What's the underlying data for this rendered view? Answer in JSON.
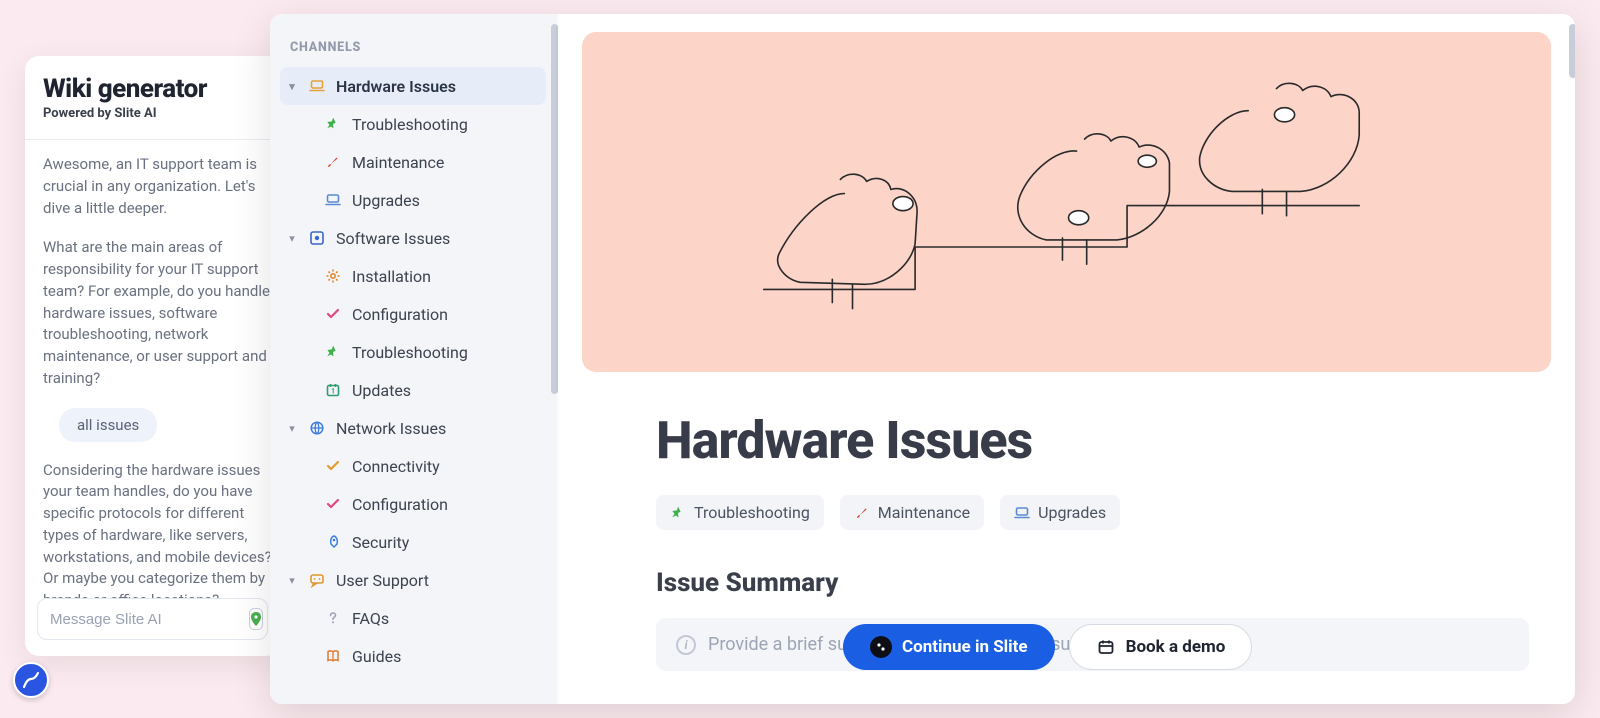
{
  "chat": {
    "title": "Wiki generator",
    "subtitle": "Powered by Slite AI",
    "messages": [
      "Awesome, an IT support team is crucial in any organization. Let's dive a little deeper.",
      "What are the main areas of responsibility for your IT support team? For example, do you handle hardware issues, software troubleshooting, network maintenance, or user support and training?"
    ],
    "user_reply": "all issues",
    "followup": "Considering the hardware issues your team handles, do you have specific protocols for different types of hardware, like servers, workstations, and mobile devices? Or maybe you categorize them by brands or office locations?",
    "input_placeholder": "Message Slite AI"
  },
  "sidebar": {
    "header": "CHANNELS",
    "channels": [
      {
        "label": "Hardware Issues",
        "icon": "laptop-icon",
        "icon_color": "#e7a13a",
        "items": [
          {
            "label": "Troubleshooting",
            "icon": "pin-icon",
            "icon_color": "#3eb24a"
          },
          {
            "label": "Maintenance",
            "icon": "brush-icon",
            "icon_color": "#e04a2f"
          },
          {
            "label": "Upgrades",
            "icon": "laptop-icon",
            "icon_color": "#5a8ad6"
          }
        ]
      },
      {
        "label": "Software Issues",
        "icon": "disc-icon",
        "icon_color": "#3a66d0",
        "items": [
          {
            "label": "Installation",
            "icon": "gear-icon",
            "icon_color": "#d98a2e"
          },
          {
            "label": "Configuration",
            "icon": "check-heart-icon",
            "icon_color": "#e04a7d"
          },
          {
            "label": "Troubleshooting",
            "icon": "pin-icon",
            "icon_color": "#3eb24a"
          },
          {
            "label": "Updates",
            "icon": "calendar-box-icon",
            "icon_color": "#2e9e70"
          }
        ]
      },
      {
        "label": "Network Issues",
        "icon": "globe-icon",
        "icon_color": "#3a7de0",
        "items": [
          {
            "label": "Connectivity",
            "icon": "check-diamond-icon",
            "icon_color": "#e59a2e"
          },
          {
            "label": "Configuration",
            "icon": "check-heart-icon",
            "icon_color": "#e04a7d"
          },
          {
            "label": "Security",
            "icon": "rocket-icon",
            "icon_color": "#3a7de0"
          }
        ]
      },
      {
        "label": "User Support",
        "icon": "chat-icon",
        "icon_color": "#e0962e",
        "items": [
          {
            "label": "FAQs",
            "icon": "question-icon",
            "icon_color": "#9aa1b0"
          },
          {
            "label": "Guides",
            "icon": "book-icon",
            "icon_color": "#e07a2e"
          }
        ]
      }
    ]
  },
  "document": {
    "title": "Hardware Issues",
    "tags": [
      {
        "label": "Troubleshooting",
        "icon": "pin-icon",
        "icon_color": "#3eb24a"
      },
      {
        "label": "Maintenance",
        "icon": "brush-icon",
        "icon_color": "#e04a2f"
      },
      {
        "label": "Upgrades",
        "icon": "laptop-icon",
        "icon_color": "#5a8ad6"
      }
    ],
    "section_heading": "Issue Summary",
    "hint_text": "Provide a brief summary of the hardware issue"
  },
  "cta": {
    "primary": "Continue in Slite",
    "secondary": "Book a demo"
  }
}
